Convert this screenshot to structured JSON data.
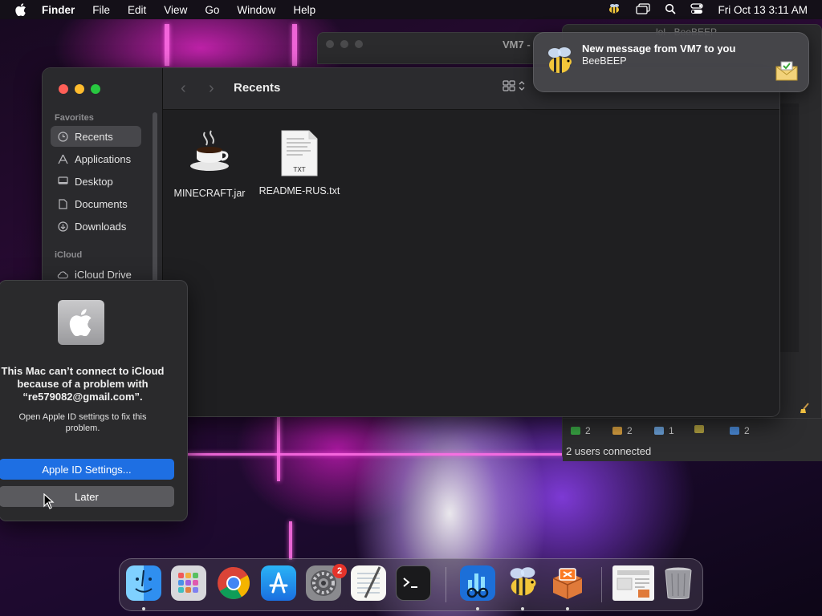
{
  "menubar": {
    "app_name": "Finder",
    "menus": [
      "File",
      "Edit",
      "View",
      "Go",
      "Window",
      "Help"
    ],
    "datetime": "Fri Oct 13  3:11 AM"
  },
  "background_windows": {
    "vm7_title": "VM7 -",
    "beebeep_title": "lol - BeeBEEP",
    "beebeep_stats": [
      "2",
      "2",
      "1",
      "",
      "2"
    ],
    "beebeep_users": "2 users connected"
  },
  "finder": {
    "title": "Recents",
    "sidebar": {
      "favorites_header": "Favorites",
      "items": [
        {
          "label": "Recents",
          "icon": "clock-icon"
        },
        {
          "label": "Applications",
          "icon": "applications-icon"
        },
        {
          "label": "Desktop",
          "icon": "desktop-icon"
        },
        {
          "label": "Documents",
          "icon": "document-icon"
        },
        {
          "label": "Downloads",
          "icon": "download-icon"
        }
      ],
      "icloud_header": "iCloud",
      "icloud_items": [
        {
          "label": "iCloud Drive",
          "icon": "cloud-icon"
        }
      ]
    },
    "files": [
      {
        "name": "MINECRAFT.jar",
        "icon": "java-coffee-icon"
      },
      {
        "name": "README-RUS.txt",
        "icon": "txt-file-icon",
        "badge": "TXT"
      }
    ]
  },
  "icloud_dialog": {
    "message": "This Mac can’t connect to iCloud because of a problem with “re579082@gmail.com”.",
    "sub": "Open Apple ID settings to fix this problem.",
    "primary_button": "Apple ID Settings...",
    "secondary_button": "Later"
  },
  "notification": {
    "title": "New message from VM7 to you",
    "body": "BeeBEEP"
  },
  "dock": {
    "apps": [
      "Finder",
      "Launchpad",
      "Google Chrome",
      "App Store",
      "System Settings",
      "TextEdit",
      "Terminal",
      "Glances",
      "BeeBEEP",
      "XAMPP",
      "Document",
      "Trash"
    ],
    "settings_badge": "2"
  },
  "colors": {
    "accent": "#1e6fe3",
    "badge": "#e5332a",
    "traffic_red": "#ff5f57",
    "traffic_yellow": "#febc2e",
    "traffic_green": "#28c840"
  }
}
